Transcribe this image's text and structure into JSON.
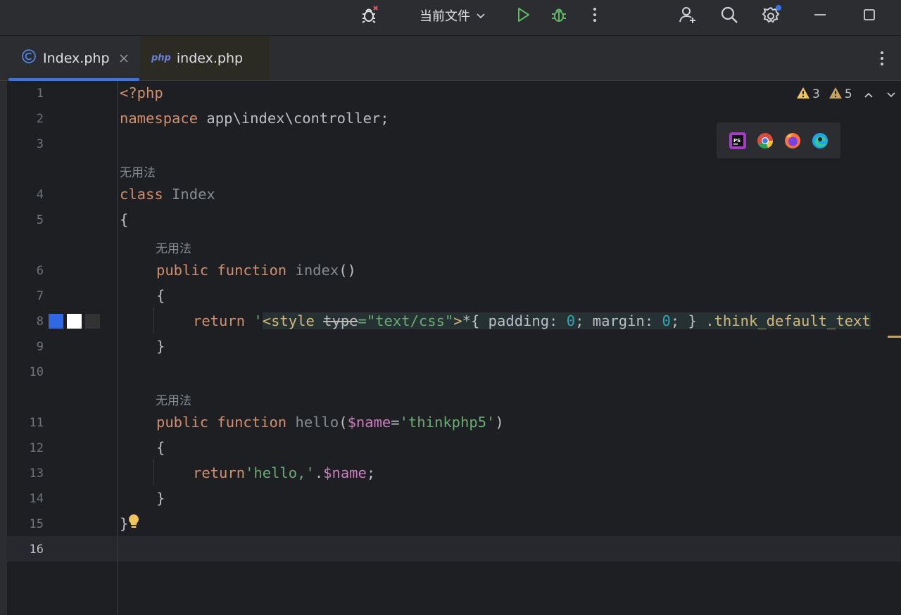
{
  "titlebar": {
    "run_config": "当前文件",
    "icons": [
      "debug-stopped-icon",
      "chevron-down-icon",
      "run-icon",
      "debug-icon",
      "more-vertical-icon",
      "add-user-icon",
      "search-icon",
      "settings-icon",
      "minimize-icon",
      "maximize-icon"
    ]
  },
  "tabs": [
    {
      "label": "Index.php",
      "icon": "class-icon",
      "active": true
    },
    {
      "label": "index.php",
      "icon_text": "php",
      "active": false
    }
  ],
  "inspections": {
    "warnings": "3",
    "weak_warnings": "5"
  },
  "hints": {
    "unused": "无用法"
  },
  "line_numbers": [
    "1",
    "2",
    "3",
    "4",
    "5",
    "6",
    "7",
    "8",
    "9",
    "10",
    "11",
    "12",
    "13",
    "14",
    "15",
    "16"
  ],
  "code": {
    "l1": "<?php",
    "l2_kw": "namespace",
    "l2_rest": " app\\index\\controller;",
    "l4_kw": "class",
    "l4_name": " Index",
    "l5": "{",
    "l6_mod": "public",
    "l6_fn": " function",
    "l6_name": " index",
    "l6_paren": "()",
    "l7": "{",
    "l8_kw": "return",
    "l8_q": " '",
    "l8_tag": "<style",
    "l8_attr": "type",
    "l8_eq": "=",
    "l8_val": "\"text/css\"",
    "l8_gt": ">",
    "l8_css1": "*{ padding: ",
    "l8_n1": "0",
    "l8_css2": "; margin: ",
    "l8_n2": "0",
    "l8_css3": "; } ",
    "l8_sel": ".think_default_text",
    "l9": "}",
    "l11_mod": "public",
    "l11_fn": " function",
    "l11_name": " hello",
    "l11_p1": "(",
    "l11_var": "$name",
    "l11_eq": "=",
    "l11_str": "'thinkphp5'",
    "l11_p2": ")",
    "l12": "{",
    "l13_kw": "return",
    "l13_str": "'hello,'",
    "l13_dot": ".",
    "l13_var": "$name",
    "l13_semi": ";",
    "l14": "}",
    "l15": "}"
  },
  "colors": {
    "accent": "#3574f0",
    "swatches": [
      "#3067e3",
      "#ffffff",
      "#333333"
    ]
  },
  "browser_popup": [
    "phpstorm-icon",
    "chrome-icon",
    "firefox-icon",
    "edge-icon"
  ]
}
